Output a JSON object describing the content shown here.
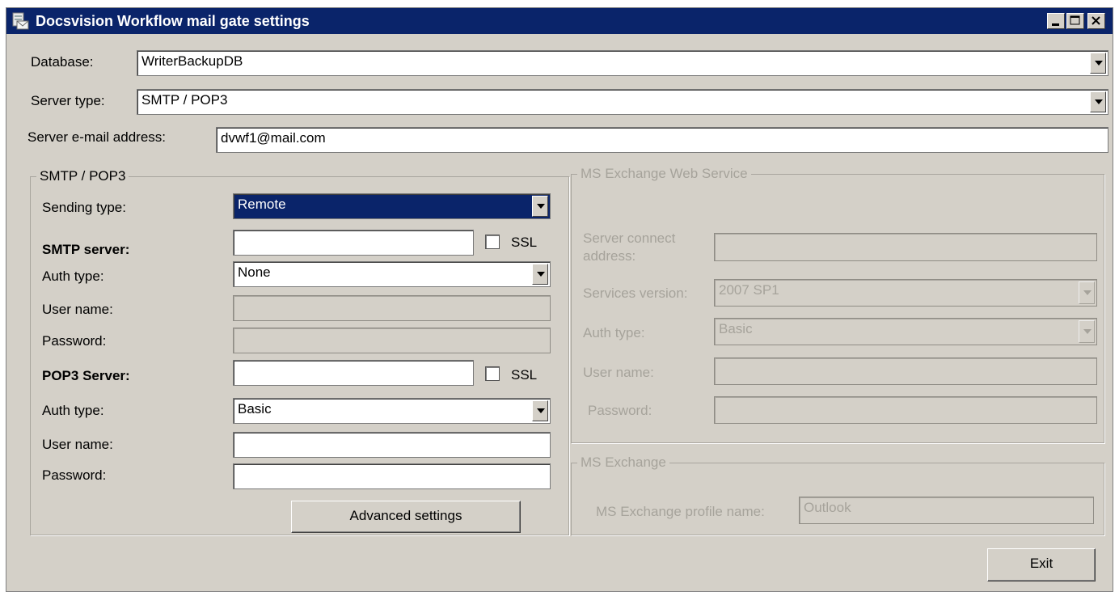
{
  "window": {
    "title": "Docsvision Workflow mail gate settings"
  },
  "top": {
    "database_label": "Database:",
    "database_value": "WriterBackupDB",
    "server_type_label": "Server type:",
    "server_type_value": "SMTP / POP3",
    "server_email_label": "Server e-mail address:",
    "server_email_value": "dvwf1@mail.com"
  },
  "smtp_pop3": {
    "legend": "SMTP / POP3",
    "sending_type_label": "Sending type:",
    "sending_type_value": "Remote",
    "smtp_server_label": "SMTP server:",
    "smtp_server_value": "",
    "ssl_label": "SSL",
    "smtp_auth_label": "Auth type:",
    "smtp_auth_value": "None",
    "smtp_user_label": "User name:",
    "smtp_password_label": "Password:",
    "pop3_server_label": "POP3 Server:",
    "pop3_server_value": "",
    "pop3_ssl_label": "SSL",
    "pop3_auth_label": "Auth type:",
    "pop3_auth_value": "Basic",
    "pop3_user_label": "User name:",
    "pop3_password_label": "Password:",
    "advanced_button": "Advanced settings"
  },
  "ews": {
    "legend": "MS Exchange Web Service",
    "connect_label_line1": "Server connect",
    "connect_label_line2": "address:",
    "services_version_label": "Services version:",
    "services_version_value": "2007 SP1",
    "auth_label": "Auth type:",
    "auth_value": "Basic",
    "user_label": "User name:",
    "password_label": "Password:"
  },
  "exchange": {
    "legend": "MS Exchange",
    "profile_label": "MS Exchange profile name:",
    "profile_value": "Outlook"
  },
  "footer": {
    "exit_button": "Exit"
  },
  "colors": {
    "titlebar": "#0a246a",
    "window_bg": "#d4d0c8",
    "selection": "#0a246a"
  }
}
